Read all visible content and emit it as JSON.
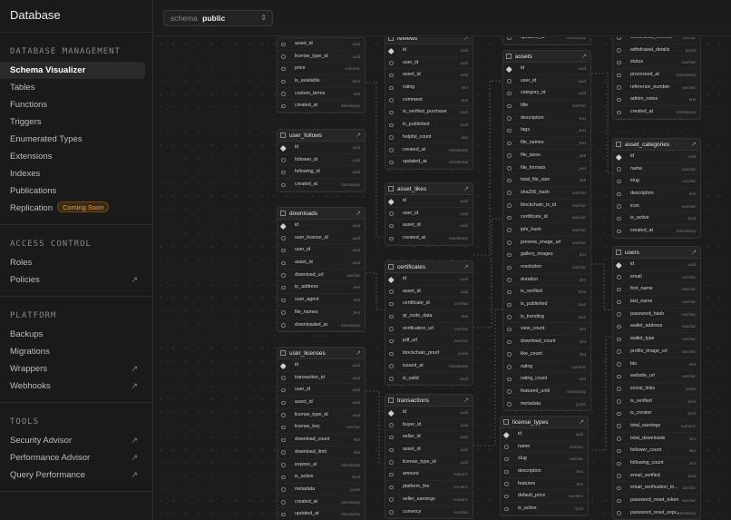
{
  "app_title": "Database",
  "sidebar": {
    "sections": [
      {
        "heading": "DATABASE MANAGEMENT",
        "items": [
          {
            "label": "Schema Visualizer",
            "active": true
          },
          {
            "label": "Tables"
          },
          {
            "label": "Functions"
          },
          {
            "label": "Triggers"
          },
          {
            "label": "Enumerated Types"
          },
          {
            "label": "Extensions"
          },
          {
            "label": "Indexes"
          },
          {
            "label": "Publications"
          },
          {
            "label": "Replication",
            "badge": "Coming Soon"
          }
        ]
      },
      {
        "heading": "ACCESS CONTROL",
        "items": [
          {
            "label": "Roles"
          },
          {
            "label": "Policies",
            "external": true
          }
        ]
      },
      {
        "heading": "PLATFORM",
        "items": [
          {
            "label": "Backups"
          },
          {
            "label": "Migrations"
          },
          {
            "label": "Wrappers",
            "external": true
          },
          {
            "label": "Webhooks",
            "external": true
          }
        ]
      },
      {
        "heading": "TOOLS",
        "items": [
          {
            "label": "Security Advisor",
            "external": true
          },
          {
            "label": "Performance Advisor",
            "external": true
          },
          {
            "label": "Query Performance",
            "external": true
          }
        ]
      }
    ]
  },
  "schema_selector": {
    "label": "schema",
    "value": "public"
  },
  "tables": [
    {
      "name": "",
      "no_header": true,
      "rows": [
        [
          "asset_id",
          "uuid"
        ],
        [
          "license_type_id",
          "uuid"
        ],
        [
          "price",
          "numeric"
        ],
        [
          "is_available",
          "bool"
        ],
        [
          "custom_terms",
          "text"
        ],
        [
          "created_at",
          "timestamp"
        ]
      ]
    },
    {
      "name": "user_follows",
      "rows": [
        [
          "id",
          "uuid"
        ],
        [
          "follower_id",
          "uuid"
        ],
        [
          "following_id",
          "uuid"
        ],
        [
          "created_at",
          "timestamp"
        ]
      ]
    },
    {
      "name": "downloads",
      "rows": [
        [
          "id",
          "uuid"
        ],
        [
          "user_license_id",
          "uuid"
        ],
        [
          "user_id",
          "uuid"
        ],
        [
          "asset_id",
          "uuid"
        ],
        [
          "download_url",
          "varchar"
        ],
        [
          "ip_address",
          "inet"
        ],
        [
          "user_agent",
          "text"
        ],
        [
          "file_names",
          "_text"
        ],
        [
          "downloaded_at",
          "timestamp"
        ]
      ]
    },
    {
      "name": "user_licenses",
      "rows": [
        [
          "id",
          "uuid"
        ],
        [
          "transaction_id",
          "uuid"
        ],
        [
          "user_id",
          "uuid"
        ],
        [
          "asset_id",
          "uuid"
        ],
        [
          "license_type_id",
          "uuid"
        ],
        [
          "license_key",
          "varchar"
        ],
        [
          "download_count",
          "int4"
        ],
        [
          "download_limit",
          "int4"
        ],
        [
          "expires_at",
          "timestamp"
        ],
        [
          "is_active",
          "bool"
        ],
        [
          "metadata",
          "jsonb"
        ],
        [
          "created_at",
          "timestamp"
        ],
        [
          "updated_at",
          "timestamp"
        ]
      ]
    },
    {
      "name": "reviews",
      "rows": [
        [
          "id",
          "uuid"
        ],
        [
          "user_id",
          "uuid"
        ],
        [
          "asset_id",
          "uuid"
        ],
        [
          "rating",
          "int4"
        ],
        [
          "comment",
          "text"
        ],
        [
          "is_verified_purchase",
          "bool"
        ],
        [
          "is_published",
          "bool"
        ],
        [
          "helpful_count",
          "int4"
        ],
        [
          "created_at",
          "timestamp"
        ],
        [
          "updated_at",
          "timestamp"
        ]
      ]
    },
    {
      "name": "asset_likes",
      "rows": [
        [
          "id",
          "uuid"
        ],
        [
          "user_id",
          "uuid"
        ],
        [
          "asset_id",
          "uuid"
        ],
        [
          "created_at",
          "timestamp"
        ]
      ]
    },
    {
      "name": "certificates",
      "rows": [
        [
          "id",
          "uuid"
        ],
        [
          "asset_id",
          "uuid"
        ],
        [
          "certificate_id",
          "varchar"
        ],
        [
          "qr_code_data",
          "text"
        ],
        [
          "verification_url",
          "varchar"
        ],
        [
          "pdf_url",
          "varchar"
        ],
        [
          "blockchain_proof",
          "jsonb"
        ],
        [
          "issued_at",
          "timestamp"
        ],
        [
          "is_valid",
          "bool"
        ]
      ]
    },
    {
      "name": "transactions",
      "rows": [
        [
          "id",
          "uuid"
        ],
        [
          "buyer_id",
          "uuid"
        ],
        [
          "seller_id",
          "uuid"
        ],
        [
          "asset_id",
          "uuid"
        ],
        [
          "license_type_id",
          "uuid"
        ],
        [
          "amount",
          "numeric"
        ],
        [
          "platform_fee",
          "numeric"
        ],
        [
          "seller_earnings",
          "numeric"
        ],
        [
          "currency",
          "varchar"
        ]
      ]
    },
    {
      "name": "",
      "no_header": true,
      "rows": [
        [
          "updated_at",
          "timestamp"
        ]
      ]
    },
    {
      "name": "assets",
      "rows": [
        [
          "id",
          "uuid"
        ],
        [
          "user_id",
          "uuid"
        ],
        [
          "category_id",
          "uuid"
        ],
        [
          "title",
          "varchar"
        ],
        [
          "description",
          "text"
        ],
        [
          "tags",
          "_text"
        ],
        [
          "file_names",
          "_text"
        ],
        [
          "file_sizes",
          "_int8"
        ],
        [
          "file_formats",
          "_text"
        ],
        [
          "total_file_size",
          "int8"
        ],
        [
          "sha256_hash",
          "varchar"
        ],
        [
          "blockchain_tx_id",
          "varchar"
        ],
        [
          "certificate_id",
          "varchar"
        ],
        [
          "ipfs_hash",
          "varchar"
        ],
        [
          "preview_image_url",
          "varchar"
        ],
        [
          "gallery_images",
          "_text"
        ],
        [
          "resolution",
          "varchar"
        ],
        [
          "duration",
          "int4"
        ],
        [
          "is_verified",
          "bool"
        ],
        [
          "is_published",
          "bool"
        ],
        [
          "is_trending",
          "bool"
        ],
        [
          "view_count",
          "int4"
        ],
        [
          "download_count",
          "int4"
        ],
        [
          "like_count",
          "int4"
        ],
        [
          "rating",
          "numeric"
        ],
        [
          "rating_count",
          "int4"
        ],
        [
          "featured_until",
          "timestamp"
        ],
        [
          "metadata",
          "jsonb"
        ]
      ]
    },
    {
      "name": "license_types",
      "rows": [
        [
          "id",
          "uuid"
        ],
        [
          "name",
          "varchar"
        ],
        [
          "slug",
          "varchar"
        ],
        [
          "description",
          "text"
        ],
        [
          "features",
          "_text"
        ],
        [
          "default_price",
          "numeric"
        ],
        [
          "is_active",
          "bool"
        ]
      ]
    },
    {
      "name": "",
      "no_header": true,
      "rows": [
        [
          "withdrawal_method",
          "varchar"
        ],
        [
          "withdrawal_details",
          "jsonb"
        ],
        [
          "status",
          "varchar"
        ],
        [
          "processed_at",
          "timestamp"
        ],
        [
          "reference_number",
          "varchar"
        ],
        [
          "admin_notes",
          "text"
        ],
        [
          "created_at",
          "timestamp"
        ]
      ]
    },
    {
      "name": "asset_categories",
      "rows": [
        [
          "id",
          "uuid"
        ],
        [
          "name",
          "varchar"
        ],
        [
          "slug",
          "varchar"
        ],
        [
          "description",
          "text"
        ],
        [
          "icon",
          "varchar"
        ],
        [
          "is_active",
          "bool"
        ],
        [
          "created_at",
          "timestamp"
        ]
      ]
    },
    {
      "name": "users",
      "rows": [
        [
          "id",
          "uuid"
        ],
        [
          "email",
          "varchar"
        ],
        [
          "first_name",
          "varchar"
        ],
        [
          "last_name",
          "varchar"
        ],
        [
          "password_hash",
          "varchar"
        ],
        [
          "wallet_address",
          "varchar"
        ],
        [
          "wallet_type",
          "varchar"
        ],
        [
          "profile_image_url",
          "varchar"
        ],
        [
          "bio",
          "text"
        ],
        [
          "website_url",
          "varchar"
        ],
        [
          "social_links",
          "jsonb"
        ],
        [
          "is_verified",
          "bool"
        ],
        [
          "is_creator",
          "bool"
        ],
        [
          "total_earnings",
          "numeric"
        ],
        [
          "total_downloads",
          "int4"
        ],
        [
          "follower_count",
          "int4"
        ],
        [
          "following_count",
          "int4"
        ],
        [
          "email_verified",
          "bool"
        ],
        [
          "email_verification_to...",
          "varchar"
        ],
        [
          "password_reset_token",
          "varchar"
        ],
        [
          "password_reset_expi...",
          "timestamp"
        ]
      ]
    }
  ]
}
